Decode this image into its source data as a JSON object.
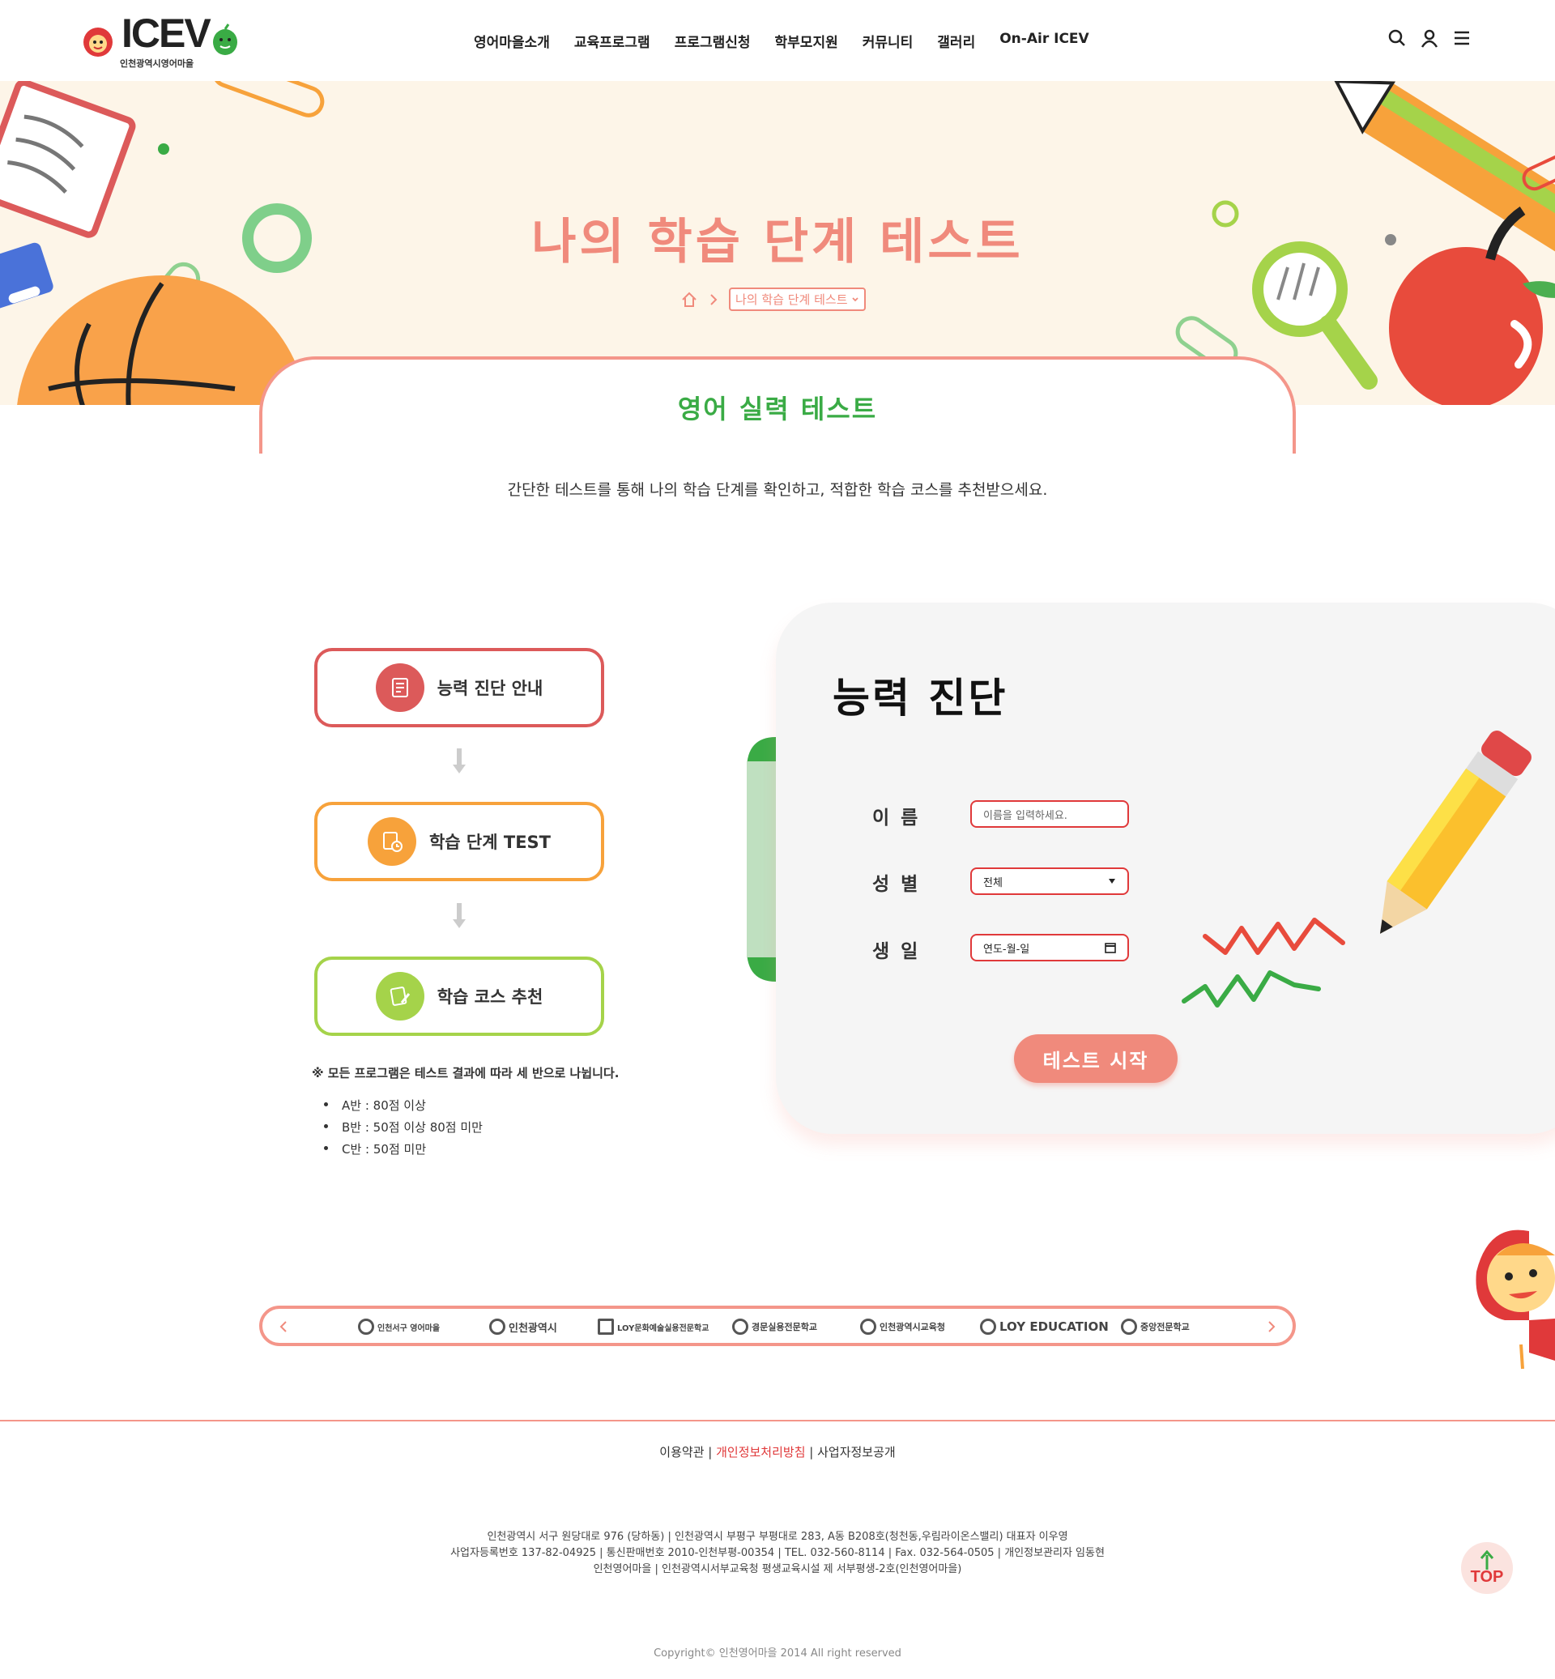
{
  "header": {
    "logo_text": "ICEV",
    "logo_sub": "인천광역시영어마을",
    "nav": [
      "영어마을소개",
      "교육프로그램",
      "프로그램신청",
      "학부모지원",
      "커뮤니티",
      "갤러리",
      "On-Air ICEV"
    ]
  },
  "hero": {
    "title": "나의 학습 단계 테스트",
    "breadcrumb_current": "나의 학습 단계 테스트"
  },
  "section": {
    "title": "영어 실력 테스트",
    "intro": "간단한 테스트를 통해 나의 학습 단계를 확인하고, 적합한 학습 코스를 추천받으세요."
  },
  "steps": [
    {
      "label": "능력 진단 안내",
      "color": "#dc5a5a"
    },
    {
      "label": "학습 단계 TEST",
      "color": "#f7a23b"
    },
    {
      "label": "학습 코스 추천",
      "color": "#a5d34a"
    }
  ],
  "note": "※ 모든 프로그램은 테스트 결과에 따라 세 반으로 나뉩니다.",
  "classes": [
    "A반 : 80점 이상",
    "B반 : 50점 이상 80점 미만",
    "C반 : 50점 미만"
  ],
  "form": {
    "title": "능력 진단",
    "name_label": "이름",
    "name_placeholder": "이름을 입력하세요.",
    "gender_label": "성별",
    "gender_value": "전체",
    "birth_label": "생일",
    "birth_value": "연도-월-일",
    "submit_label": "테스트 시작"
  },
  "partners": [
    "인천서구 영어마을",
    "인천광역시",
    "LOY문화예술실용전문학교",
    "경문실용전문학교",
    "인천광역시교육청",
    "LOY EDUCATION",
    "중앙전문학교"
  ],
  "footer": {
    "link1": "이용약관",
    "link2": "개인정보처리방침",
    "link3": "사업자정보공개",
    "info1": "인천광역시 서구 원당대로 976 (당하동) | 인천광역시 부평구 부평대로 283, A동 B208호(청천동,우림라이온스밸리) 대표자 이우영",
    "info2": "사업자등록번호 137-82-04925 | 통신판매번호 2010-인천부평-00354 | TEL. 032-560-8114 | Fax. 032-564-0505 | 개인정보관리자 임동현",
    "info3": "인천영어마을 | 인천광역시서부교육청 평생교육시설 제 서부평생-2호(인천영어마을)",
    "copyright": "Copyright© 인천영어마을 2014 All right reserved",
    "top_label": "TOP"
  },
  "colors": {
    "accent": "#f08a7c",
    "green": "#3aab45",
    "red": "#e0393a",
    "hero_bg": "#fdf5e8"
  }
}
